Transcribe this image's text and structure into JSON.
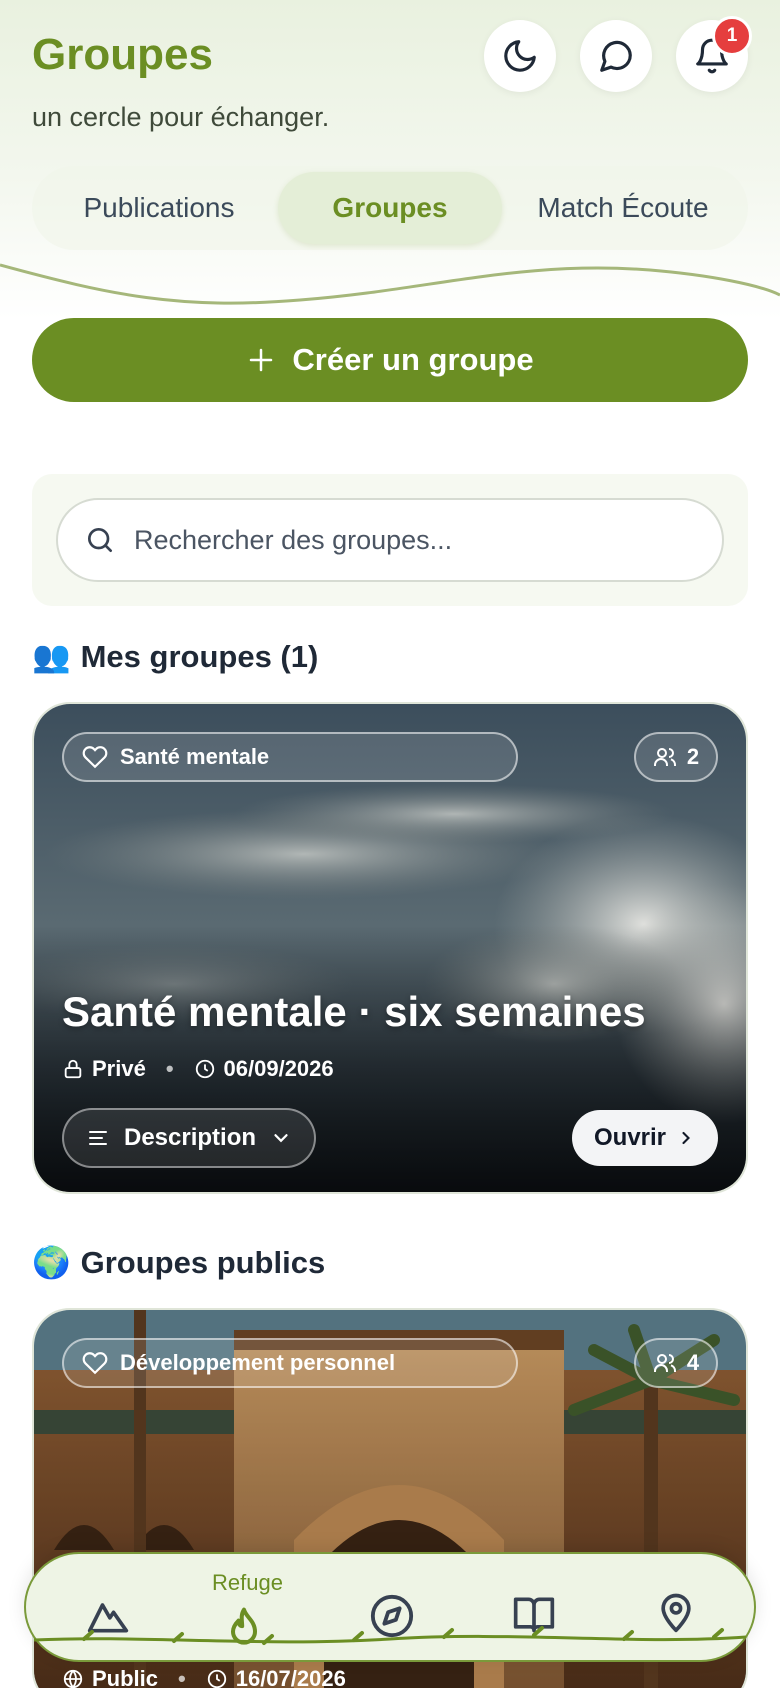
{
  "header": {
    "title": "Groupes",
    "subtitle": "un cercle pour échanger.",
    "notifications_count": "1"
  },
  "tabs": [
    {
      "label": "Publications",
      "active": false
    },
    {
      "label": "Groupes",
      "active": true
    },
    {
      "label": "Match Écoute",
      "active": false
    }
  ],
  "create_button": {
    "label": "Créer un groupe"
  },
  "search": {
    "placeholder": "Rechercher des groupes..."
  },
  "my_groups": {
    "title_emoji": "👥",
    "title": "Mes groupes (1)",
    "cards": [
      {
        "category": "Santé mentale",
        "members": "2",
        "name": "Santé mentale · six semaines",
        "visibility": "Privé",
        "date": "06/09/2026",
        "description_label": "Description",
        "open_label": "Ouvrir"
      }
    ]
  },
  "public_groups": {
    "title_emoji": "🌍",
    "title": "Groupes publics",
    "cards": [
      {
        "category": "Développement personnel",
        "members": "4",
        "visibility": "Public",
        "date": "16/07/2026"
      }
    ]
  },
  "bottom_nav": {
    "active_label": "Refuge",
    "items": [
      "mountain-icon",
      "flame-icon",
      "compass-icon",
      "book-icon",
      "map-pin-icon"
    ]
  },
  "colors": {
    "accent": "#6b8e23",
    "badge": "#e53e3e"
  }
}
